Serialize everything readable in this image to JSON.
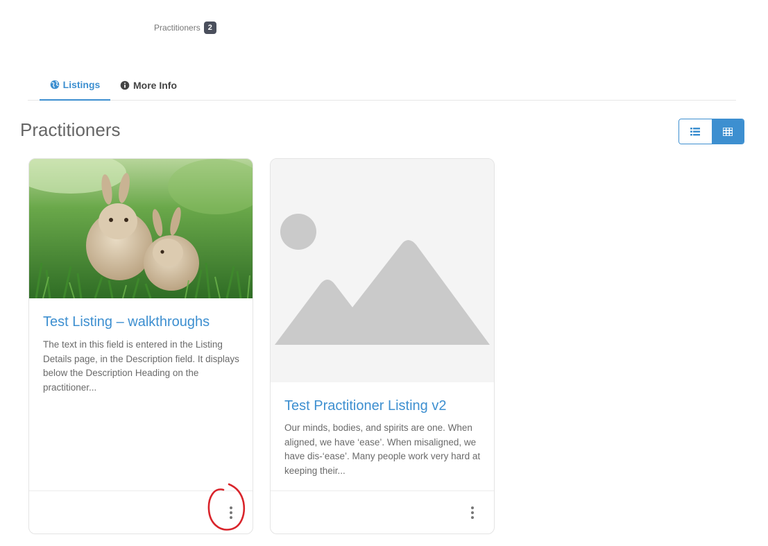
{
  "header": {
    "count_label": "Practitioners",
    "count_value": "2"
  },
  "tabs": [
    {
      "label": "Listings",
      "icon": "globe-icon",
      "active": true
    },
    {
      "label": "More Info",
      "icon": "info-circle-icon",
      "active": false
    }
  ],
  "section": {
    "title": "Practitioners"
  },
  "view_toggle": {
    "options": [
      "list-view-icon",
      "grid-view-icon"
    ],
    "selected": "grid"
  },
  "cards": [
    {
      "title": "Test Listing – walkthroughs",
      "description": "The text in this field is entered in the Listing Details page, in the Description field. It displays below the Description Heading on the practitioner...",
      "image": "rabbits-photo",
      "menu_icon": "kebab-menu-icon"
    },
    {
      "title": "Test Practitioner Listing v2",
      "description": "Our minds, bodies, and spirits are one. When aligned, we have ‘ease’. When misaligned, we have dis-‘ease’. Many people work very hard at keeping their...",
      "image": "image-placeholder",
      "menu_icon": "kebab-menu-icon"
    }
  ],
  "colors": {
    "accent": "#3d8fd0",
    "badge": "#4a4f5c",
    "annotation": "#d9242b"
  }
}
